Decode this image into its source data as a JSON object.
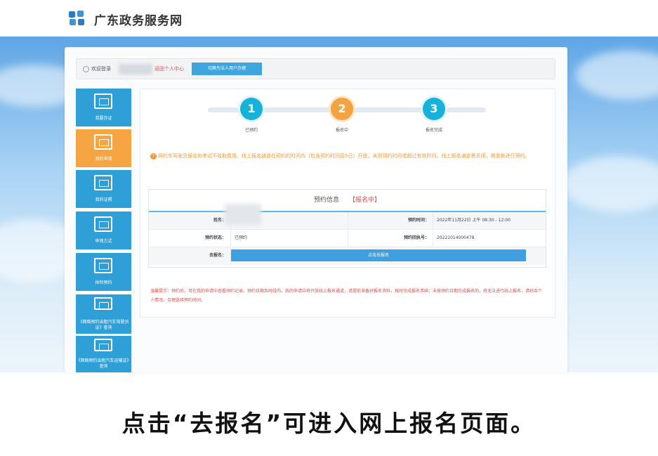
{
  "header": {
    "site_title": "广东政务服务网"
  },
  "userbar": {
    "welcome": "欢迎登录",
    "back_link": "返回个人中心",
    "switch_button": "切换为法人用户办理"
  },
  "sidebar": {
    "items": [
      {
        "label": "我要办证"
      },
      {
        "label": "我的申请"
      },
      {
        "label": "我的证照"
      },
      {
        "label": "申领方式"
      },
      {
        "label": "体检预约"
      },
      {
        "label": "《网络预约出租汽车驾驶员证》查询"
      },
      {
        "label": "《网络预约出租汽车运输证》查询"
      }
    ]
  },
  "steps": [
    {
      "number": "1",
      "label": "已预约"
    },
    {
      "number": "2",
      "label": "报名中"
    },
    {
      "number": "3",
      "label": "报名完成"
    }
  ],
  "notice": "网约车驾驶员报名和考试不收取费用。线上报名通道在预约的时间内（包含预约时间后5日）开放，未到预约时间或超过有效时间，线上报名通道将关闭，需重新进行预约。",
  "info": {
    "title": "预约信息",
    "status": "【报名中】",
    "rows": [
      {
        "k1": "姓名：",
        "v1": "",
        "k2": "预约时间：",
        "v2": "2022年11月22日 上午 08:30 - 12:00"
      },
      {
        "k1": "预约状态：",
        "v1": "已预约",
        "k2": "预约回执号：",
        "v2": "20221014000478"
      }
    ],
    "action_key": "去报名：",
    "action_button": "点击去报名"
  },
  "tip": "温馨提示：预约后，可在我的申请中查看预约记录。预约日期及时段内，我的申请中将开放线上报名通道，请提前准备好报名资料，按时完成报名手续；未按预约日期完成报名的，将无法进行线上报名，请综合个人情况，合理选择预约时间。",
  "caption": "点击“去报名”可进入网上报名页面。",
  "colors": {
    "primary": "#2f9fd8",
    "active": "#f5a642",
    "alert": "#e34b4b"
  },
  "icons": {
    "logo": "gd-gov-logo-icon",
    "sidebar": "id-card-icon",
    "active": "edit-form-icon",
    "notice": "exclamation-icon"
  }
}
